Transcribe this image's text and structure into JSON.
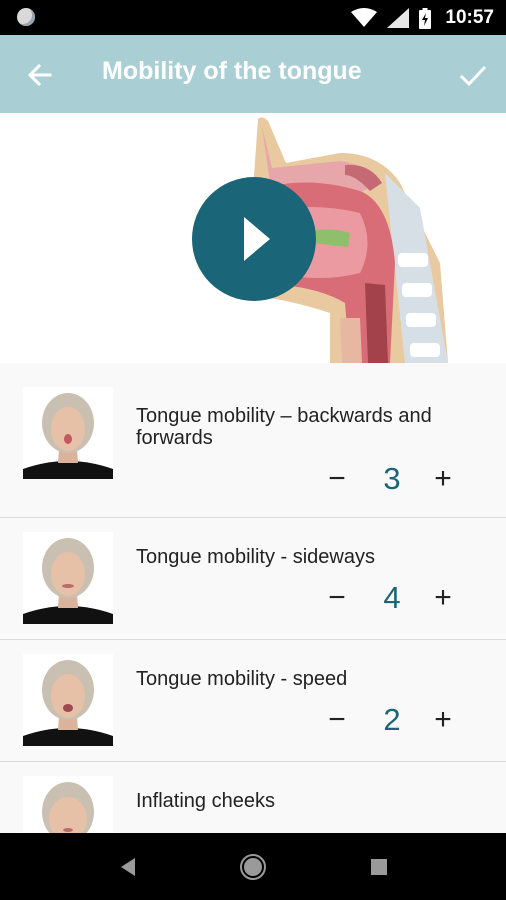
{
  "status_bar": {
    "time": "10:57",
    "icons": [
      "notification-dot-icon",
      "wifi-icon",
      "signal-icon",
      "battery-charging-icon"
    ]
  },
  "app_bar": {
    "title": "Mobility of the tongue",
    "back_icon": "arrow-back-icon",
    "done_icon": "check-icon"
  },
  "hero": {
    "play_icon": "play-icon"
  },
  "exercises": [
    {
      "title": "Tongue mobility – backwards and forwards",
      "count": "3",
      "minus": "−",
      "plus": "+"
    },
    {
      "title": "Tongue mobility - sideways",
      "count": "4",
      "minus": "−",
      "plus": "+"
    },
    {
      "title": "Tongue mobility - speed",
      "count": "2",
      "minus": "−",
      "plus": "+"
    },
    {
      "title": "Inflating cheeks"
    }
  ],
  "nav_bar": {
    "icons": [
      "nav-back-icon",
      "nav-home-icon",
      "nav-recents-icon"
    ]
  },
  "colors": {
    "app_bar": "#a9cfd5",
    "accent": "#1a6577",
    "background": "#f7f7f7"
  }
}
